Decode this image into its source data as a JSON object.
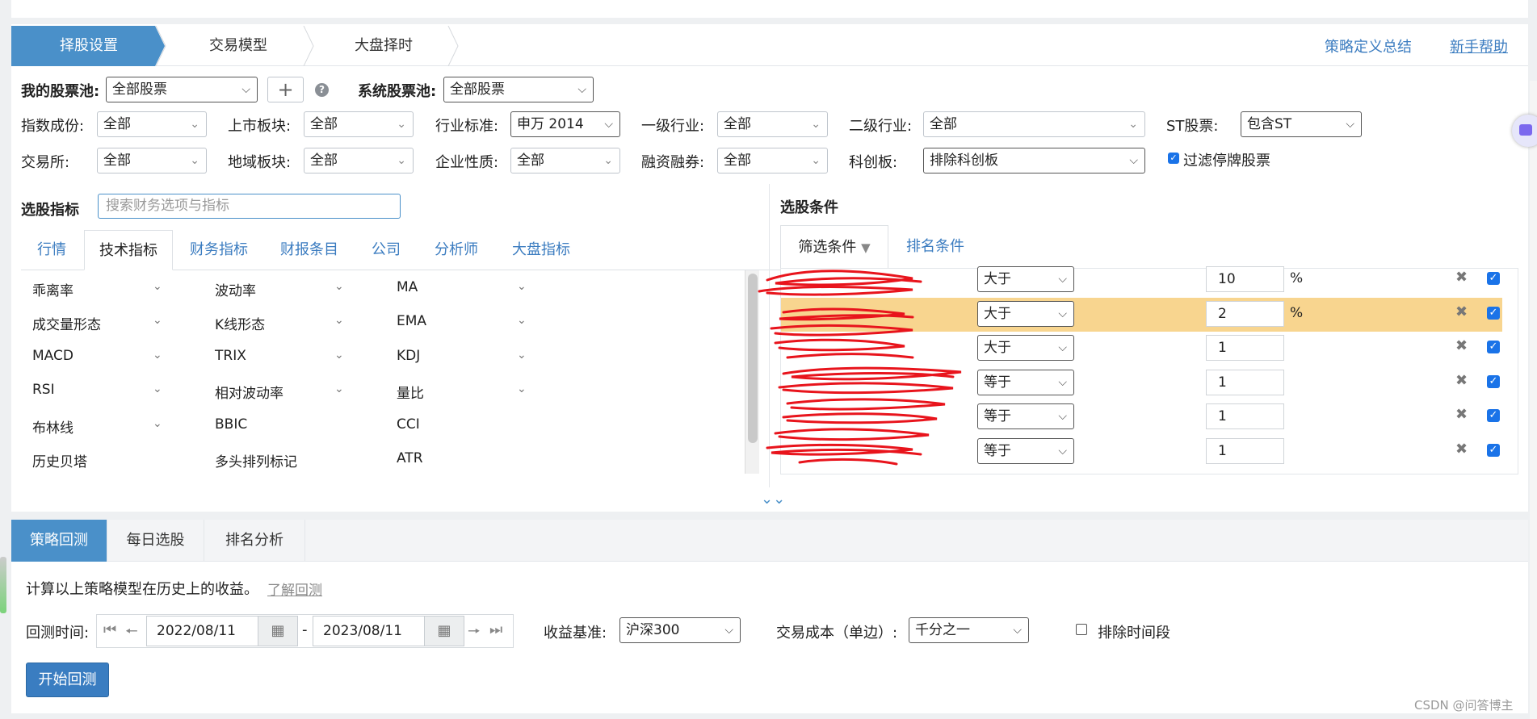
{
  "steps": [
    "择股设置",
    "交易模型",
    "大盘择时"
  ],
  "top_links": {
    "summary": "策略定义总结",
    "help": "新手帮助"
  },
  "pool": {
    "my_label": "我的股票池:",
    "my_value": "全部股票",
    "sys_label": "系统股票池:",
    "sys_value": "全部股票"
  },
  "filters_row1": [
    {
      "label": "指数成份:",
      "value": "全部"
    },
    {
      "label": "上市板块:",
      "value": "全部"
    },
    {
      "label": "行业标准:",
      "value": "申万 2014"
    },
    {
      "label": "一级行业:",
      "value": "全部"
    },
    {
      "label": "二级行业:",
      "value": "全部"
    },
    {
      "label": "ST股票:",
      "value": "包含ST"
    }
  ],
  "filters_row2": [
    {
      "label": "交易所:",
      "value": "全部"
    },
    {
      "label": "地域板块:",
      "value": "全部"
    },
    {
      "label": "企业性质:",
      "value": "全部"
    },
    {
      "label": "融资融券:",
      "value": "全部"
    },
    {
      "label": "科创板:",
      "value": "排除科创板"
    }
  ],
  "filter_suspended": "过滤停牌股票",
  "indicators": {
    "title": "选股指标",
    "search_placeholder": "搜索财务选项与指标",
    "tabs": [
      "行情",
      "技术指标",
      "财务指标",
      "财报条目",
      "公司",
      "分析师",
      "大盘指标"
    ],
    "items": [
      [
        "乖离率",
        "波动率",
        "MA"
      ],
      [
        "成交量形态",
        "K线形态",
        "EMA"
      ],
      [
        "MACD",
        "TRIX",
        "KDJ"
      ],
      [
        "RSI",
        "相对波动率",
        "量比"
      ],
      [
        "布林线",
        "BBIC",
        "CCI"
      ],
      [
        "历史贝塔",
        "多头排列标记",
        "ATR"
      ]
    ]
  },
  "conditions": {
    "title": "选股条件",
    "tabs": [
      "筛选条件",
      "排名条件"
    ],
    "rows": [
      {
        "op": "大于",
        "value": "10",
        "unit": "%"
      },
      {
        "op": "大于",
        "value": "2",
        "unit": "%"
      },
      {
        "op": "大于",
        "value": "1",
        "unit": ""
      },
      {
        "op": "等于",
        "value": "1",
        "unit": ""
      },
      {
        "op": "等于",
        "value": "1",
        "unit": ""
      },
      {
        "op": "等于",
        "value": "1",
        "unit": ""
      }
    ]
  },
  "bottom": {
    "tabs": [
      "策略回测",
      "每日选股",
      "排名分析"
    ],
    "desc": "计算以上策略模型在历史上的收益。",
    "learn_link": "了解回测",
    "period_label": "回测时间:",
    "start_date": "2022/08/11",
    "dash": "-",
    "end_date": "2023/08/11",
    "benchmark_label": "收益基准:",
    "benchmark_value": "沪深300",
    "cost_label": "交易成本（单边）:",
    "cost_value": "千分之一",
    "exclude_label": "排除时间段",
    "start_button": "开始回测"
  },
  "watermark": "CSDN @问答博主",
  "colors": {
    "accent": "#4a90c9",
    "link": "#3b7cc0",
    "highlight": "#f8d58f",
    "checkbox": "#1a73e8"
  }
}
